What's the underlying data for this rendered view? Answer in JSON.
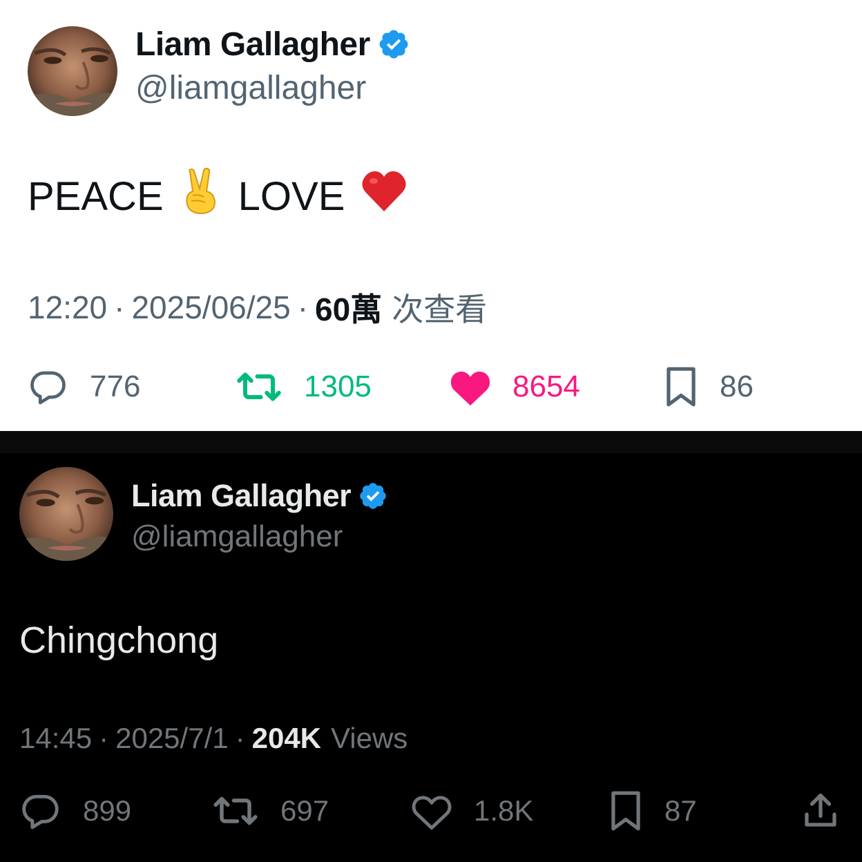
{
  "tweets": [
    {
      "theme": "light",
      "display_name": "Liam Gallagher",
      "handle": "@liamgallagher",
      "verified_icon": "verified-badge-icon",
      "text_parts": [
        "PEACE",
        "✌️",
        "LOVE",
        "❤️"
      ],
      "time": "12:20",
      "date": "2025/06/25",
      "views_count": "60萬",
      "views_label": "次查看",
      "actions": {
        "replies": "776",
        "retweets": "1305",
        "likes": "8654",
        "bookmarks": "86"
      },
      "colors": {
        "retweet": "#00ba7c",
        "like": "#f91880",
        "verified": "#1d9bf0"
      }
    },
    {
      "theme": "dark",
      "display_name": "Liam Gallagher",
      "handle": "@liamgallagher",
      "verified_icon": "verified-badge-icon",
      "text": "Chingchong",
      "time": "14:45",
      "date": "2025/7/1",
      "views_count": "204K",
      "views_label": "Views",
      "actions": {
        "replies": "899",
        "retweets": "697",
        "likes": "1.8K",
        "bookmarks": "87"
      },
      "icons": [
        "reply-icon",
        "retweet-icon",
        "like-icon",
        "bookmark-icon",
        "share-icon"
      ]
    }
  ]
}
